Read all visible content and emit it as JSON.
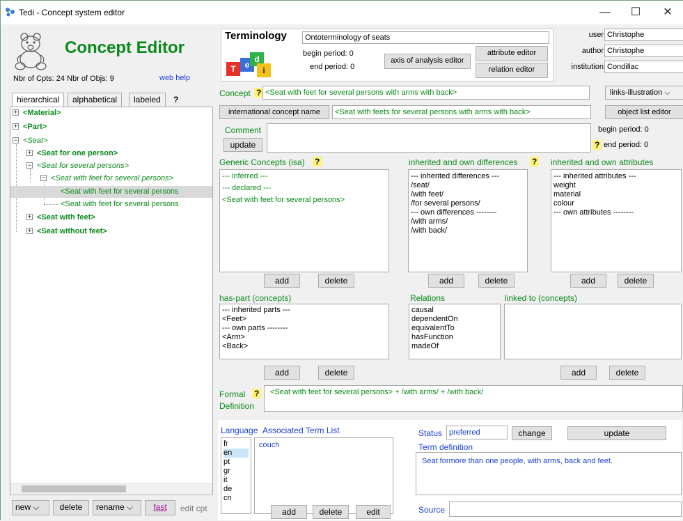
{
  "window": {
    "title": "Tedi - Concept system editor",
    "min": "—",
    "max": "☐",
    "close": "✕"
  },
  "left": {
    "app_title": "Concept Editor",
    "stats": "Nbr of Cpts: 24  Nbr of Objs:  9",
    "web_help": "web help",
    "tabs": [
      "hierarchical",
      "alphabetical",
      "labeled",
      "?"
    ],
    "tree": [
      {
        "label": "<Material>",
        "bold": true,
        "italic": false
      },
      {
        "label": "<Part>",
        "bold": true,
        "italic": false
      },
      {
        "label": "<Seat>",
        "bold": false,
        "italic": true
      },
      {
        "label": "<Seat for one person>",
        "bold": true,
        "italic": false
      },
      {
        "label": "<Seat for several persons>",
        "bold": false,
        "italic": true
      },
      {
        "label": "<Seat with feet for several persons>",
        "bold": false,
        "italic": true
      },
      {
        "label": "<Seat with feet for several persons",
        "bold": false,
        "italic": false
      },
      {
        "label": "<Seat with feet for several persons",
        "bold": false,
        "italic": false
      },
      {
        "label": "<Seat with feet>",
        "bold": true,
        "italic": false
      },
      {
        "label": "<Seat without feet>",
        "bold": true,
        "italic": false
      }
    ],
    "bottom": {
      "new": "new",
      "delete": "delete",
      "rename": "rename",
      "fast": "fast",
      "edit_cpt": "edit cpt"
    }
  },
  "terminology": {
    "label": "Terminology",
    "name": "Ontoterminology of seats",
    "begin_period": "begin period:  0",
    "end_period": "end period:  0",
    "axis_btn": "axis of analysis editor",
    "attribute_btn": "attribute editor",
    "relation_btn": "relation editor",
    "user_lbl": "user",
    "user": "Christophe",
    "author_lbl": "author",
    "author": "Christophe",
    "institution_lbl": "institution",
    "institution": "Condillac",
    "logo_letters": [
      "T",
      "e",
      "d",
      "i"
    ]
  },
  "concept": {
    "label": "Concept",
    "value": "<Seat with feet for several persons with arms with back>",
    "links_select": "links-illustration",
    "intl_btn": "international concept name",
    "intl_value": "<Seat with feets for several persons with arms with back>",
    "object_list_btn": "object list editor",
    "comment_lbl": "Comment",
    "update_btn": "update",
    "begin_period": "begin period:  0",
    "end_period": "end period:  0"
  },
  "generic": {
    "label": "Generic Concepts (isa)",
    "items": [
      "--- inferred  ---",
      "--- declared ---",
      "<Seat with feet for several persons>"
    ],
    "add": "add",
    "delete": "delete"
  },
  "differences": {
    "label": "inherited and own differences",
    "items": [
      "--- inherited differences ---",
      "/seat/",
      "/with feet/",
      "/for several persons/",
      "--- own differences --------",
      "/with arms/",
      "/with back/"
    ],
    "add": "add",
    "delete": "delete"
  },
  "attributes": {
    "label": "inherited and own attributes",
    "items": [
      "--- inherited attributes ---",
      "weight",
      "material",
      "colour",
      "--- own attributes --------"
    ],
    "add": "add",
    "delete": "delete"
  },
  "haspart": {
    "label": "has-part (concepts)",
    "items": [
      "--- inherited parts ---",
      "<Feet>",
      "--- own parts --------",
      "<Arm>",
      "<Back>"
    ],
    "add": "add",
    "delete": "delete"
  },
  "relations": {
    "label": "Relations",
    "items": [
      "causal",
      "dependentOn",
      "equivalentTo",
      "hasFunction",
      "madeOf"
    ]
  },
  "linked": {
    "label": "linked to (concepts)",
    "add": "add",
    "delete": "delete"
  },
  "formal": {
    "label1": "Formal",
    "label2": "Definition",
    "value": "<Seat with feet for several persons> + /with arms/ + /with back/"
  },
  "language": {
    "label": "Language",
    "term_list_lbl": "Associated Term List",
    "langs": [
      "fr",
      "en",
      "pt",
      "gr",
      "it",
      "de",
      "cn"
    ],
    "selected": "en",
    "terms": [
      "couch"
    ],
    "add": "add",
    "delete": "delete",
    "edit": "edit"
  },
  "status": {
    "label": "Status",
    "value": "preferred",
    "change": "change",
    "update": "update",
    "term_def_lbl": "Term definition",
    "term_def": "Seat formore than one people, with arms, back and feet.",
    "source_lbl": "Source"
  }
}
